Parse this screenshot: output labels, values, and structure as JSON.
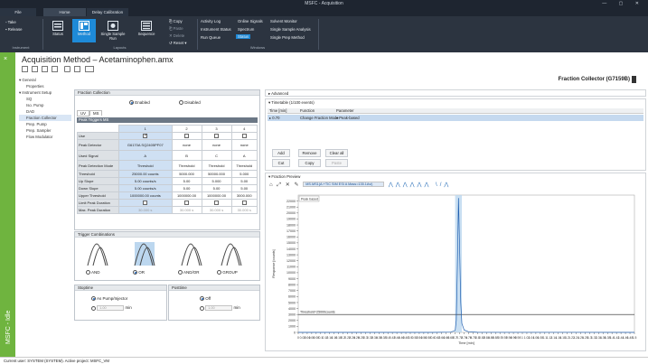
{
  "window": {
    "title": "MSFC - Acquisition",
    "controls": "—  ▢  ✕"
  },
  "tabs": [
    "File",
    "Home",
    "Delay Calibration"
  ],
  "ribbon": {
    "instrument": {
      "label": "Instrument",
      "items": [
        "Take",
        "Release"
      ]
    },
    "layouts": {
      "label": "Layouts",
      "big": [
        "Status",
        "Method",
        "Single Sample Run",
        "Sequence"
      ],
      "small": [
        "Copy",
        "Paste",
        "Delete",
        "Reset"
      ]
    },
    "windows": {
      "label": "Windows",
      "col1": [
        "Activity Log",
        "Instrument Status",
        "Run Queue"
      ],
      "col2": [
        "Online Signals",
        "Spectrum",
        "Status"
      ],
      "col3": [
        "Solvent Monitor",
        "Single Sample Analysis",
        "Single Prep Method"
      ]
    }
  },
  "sidebar": {
    "label": "MSFC - Idle",
    "close": "×"
  },
  "page": {
    "title": "Acquisition Method – Acetaminophen.amx",
    "module": "Fraction Collector (G7159B)"
  },
  "tree": [
    "General",
    "Properties",
    "Instrument Setup",
    "SQ",
    "Iso. Pump",
    "DAD",
    "Fraction Collector",
    "Prep. Pump",
    "Prep. Sampler",
    "Flow Modulator"
  ],
  "fraction_collection": {
    "header": "Fraction Collection",
    "enabled": "Enabled",
    "disabled": "Disabled",
    "subtabs": [
      "UV",
      "MS"
    ],
    "peak_trigger_header": "Peak Triggers MS",
    "columns": [
      "1",
      "2",
      "3",
      "4"
    ],
    "rows": [
      {
        "label": "Use",
        "cells": [
          "",
          "",
          "",
          ""
        ]
      },
      {
        "label": "Peak Detector",
        "cells": [
          "G6170A SQ2405PF07",
          "none",
          "none",
          "none"
        ]
      },
      {
        "label": "Used Signal",
        "cells": [
          "A",
          "B",
          "C",
          "A"
        ]
      },
      {
        "label": "Peak Detection Mode",
        "cells": [
          "Threshold",
          "Threshold",
          "Threshold",
          "Threshold"
        ]
      },
      {
        "label": "Threshold",
        "cells": [
          "25000.00 counts",
          "5000.000",
          "50000.000",
          "5.000"
        ]
      },
      {
        "label": "Up Slope",
        "cells": [
          "5.00 counts/s",
          "5.00",
          "5.000",
          "5.00"
        ]
      },
      {
        "label": "Down Slope",
        "cells": [
          "5.00 counts/s",
          "5.00",
          "5.00",
          "5.00"
        ]
      },
      {
        "label": "Upper Threshold",
        "cells": [
          "1000000.00 counts",
          "1000000.00",
          "1000000.00",
          "3000.000"
        ]
      },
      {
        "label": "Limit Peak Duration",
        "cells": [
          "",
          "",
          "",
          ""
        ]
      },
      {
        "label": "Max. Peak Duration",
        "cells": [
          "30.000 s",
          "30.000 s",
          "30.000 s",
          "30.000 s"
        ]
      }
    ]
  },
  "trigger": {
    "header": "Trigger Combinations",
    "options": [
      "AND",
      "OR",
      "AND/OR",
      "GROUP"
    ]
  },
  "stoptime": {
    "header": "Stoptime",
    "opt1": "As Pump/Injector",
    "value": "1.00",
    "unit": "min"
  },
  "posttime": {
    "header": "Posttime",
    "opt1": "Off",
    "value": "1.00",
    "unit": "min"
  },
  "advanced": {
    "label": "Advanced"
  },
  "timetable": {
    "label": "Timetable (1/100 events)",
    "headers": [
      "Time [min]",
      "Function",
      "Parameter"
    ],
    "row": [
      "0.70",
      "Change Fraction Mode",
      "Peak-based"
    ],
    "buttons": [
      "Add",
      "Remove",
      "Clear all",
      "Cut",
      "Copy",
      "Paste"
    ]
  },
  "preview": {
    "label": "Fraction Preview",
    "signal": "MS.MS1(A:+TIC SIM ESI A Mass=135.1Avi)",
    "peak_label": "Peak based",
    "threshold_label": "Threshold=25000counts"
  },
  "chart_data": {
    "type": "line",
    "title": "",
    "xlabel": "Time [min]",
    "ylabel": "Response [counts]",
    "xlim": [
      0,
      1.5
    ],
    "ylim": [
      0,
      23000
    ],
    "yticks": [
      0,
      1000,
      2000,
      3000,
      4000,
      5000,
      6000,
      7000,
      8000,
      9000,
      10000,
      11000,
      12000,
      13000,
      14000,
      15000,
      16000,
      17000,
      18000,
      19000,
      20000,
      21000,
      22000
    ],
    "xticks": [
      "0",
      "0.02",
      "0.04",
      "0.06",
      "0.08",
      "0.1",
      "0.12",
      "0.14",
      "0.16",
      "0.18",
      "0.2",
      "0.22",
      "0.24",
      "0.26",
      "0.28",
      "0.3",
      "0.32",
      "0.34",
      "0.36",
      "0.38",
      "0.4",
      "0.42",
      "0.44",
      "0.46",
      "0.48",
      "0.5",
      "0.52",
      "0.54",
      "0.56",
      "0.58",
      "0.6",
      "0.62",
      "0.64",
      "0.66",
      "0.68",
      "0.7",
      "0.72",
      "0.74",
      "0.76",
      "0.78",
      "0.8",
      "0.82",
      "0.84",
      "0.86",
      "0.88",
      "0.9",
      "0.92",
      "0.94",
      "0.96",
      "0.98",
      "1",
      "1.02",
      "1.04",
      "1.06",
      "1.08",
      "1.1",
      "1.12",
      "1.14",
      "1.16",
      "1.18",
      "1.2",
      "1.22",
      "1.24",
      "1.26",
      "1.28",
      "1.3",
      "1.32",
      "1.34",
      "1.36",
      "1.38",
      "1.4",
      "1.42",
      "1.44",
      "1.46",
      "1.48",
      "1.5"
    ],
    "threshold": 3000,
    "peak": {
      "x": 0.715,
      "y": 22500
    },
    "series": [
      {
        "x": [
          0,
          0.6,
          0.68,
          0.7,
          0.705,
          0.71,
          0.715,
          0.72,
          0.725,
          0.73,
          0.74,
          0.76,
          0.8,
          1.5
        ],
        "y": [
          0,
          0,
          50,
          300,
          2000,
          11000,
          22500,
          14000,
          5000,
          1500,
          400,
          100,
          20,
          0
        ]
      }
    ]
  },
  "status": "Current user: SYSTEM (SYSTEM). Active project: MSFC_VM"
}
